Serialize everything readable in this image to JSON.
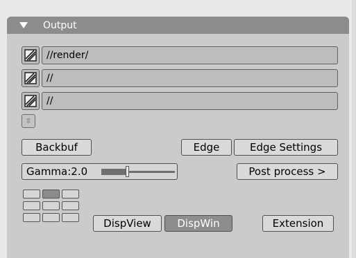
{
  "panel": {
    "title": "Output"
  },
  "paths": [
    {
      "value": "//render/"
    },
    {
      "value": "//"
    },
    {
      "value": "//"
    }
  ],
  "buttons": {
    "backbuf": "Backbuf",
    "edge": "Edge",
    "edge_settings": "Edge Settings",
    "post_process": "Post process >",
    "dispview": "DispView",
    "dispwin": "DispWin",
    "extension": "Extension"
  },
  "gamma": {
    "label": "Gamma:2.0",
    "value": 2.0,
    "slider_fraction": 0.35
  },
  "dispgrid": {
    "rows": 3,
    "cols": 3,
    "active_cell": 1
  },
  "icons": {
    "collapse": "triangle-down-icon",
    "folder": "file-browse-icon",
    "stepper": "up-down-arrows-icon"
  },
  "colors": {
    "header": "#8c8c8c",
    "panel": "#cbcbcb",
    "active_button": "#8d8d8d"
  }
}
